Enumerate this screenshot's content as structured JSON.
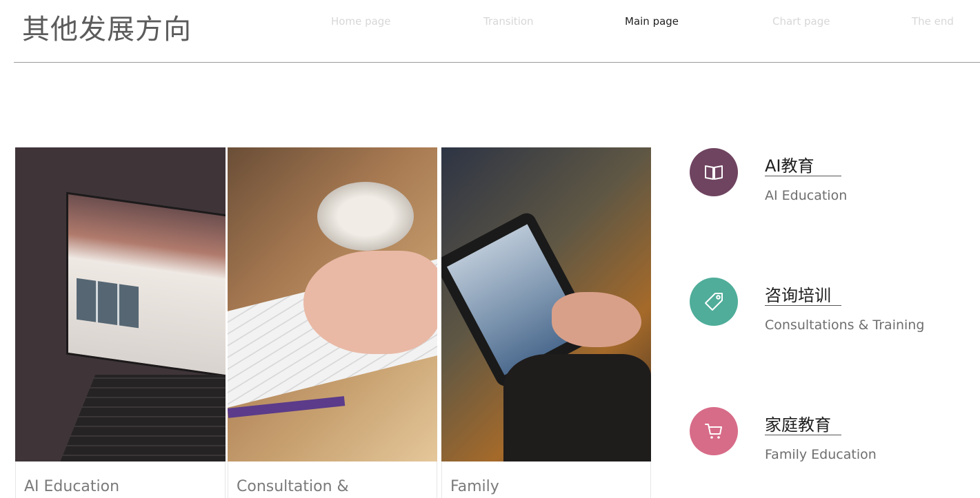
{
  "header": {
    "title": "其他发展方向",
    "nav": [
      {
        "label": "Home  page",
        "active": false
      },
      {
        "label": "Transition",
        "active": false
      },
      {
        "label": "Main page",
        "active": true
      },
      {
        "label": "Chart page",
        "active": false
      },
      {
        "label": "The end",
        "active": false
      }
    ]
  },
  "cards": [
    {
      "caption": "AI Education",
      "image": "laptop-photo"
    },
    {
      "caption": "Consultation &",
      "image": "typing-photo"
    },
    {
      "caption": "Family",
      "image": "tablet-photo"
    }
  ],
  "features": [
    {
      "title": "AI教育",
      "subtitle": "AI Education",
      "icon": "book-icon",
      "color": "#6f4460"
    },
    {
      "title": "咨询培训",
      "subtitle": "Consultations & Training",
      "icon": "tag-icon",
      "color": "#4fad9a"
    },
    {
      "title": "家庭教育",
      "subtitle": "Family Education",
      "icon": "cart-icon",
      "color": "#d76c88"
    }
  ]
}
